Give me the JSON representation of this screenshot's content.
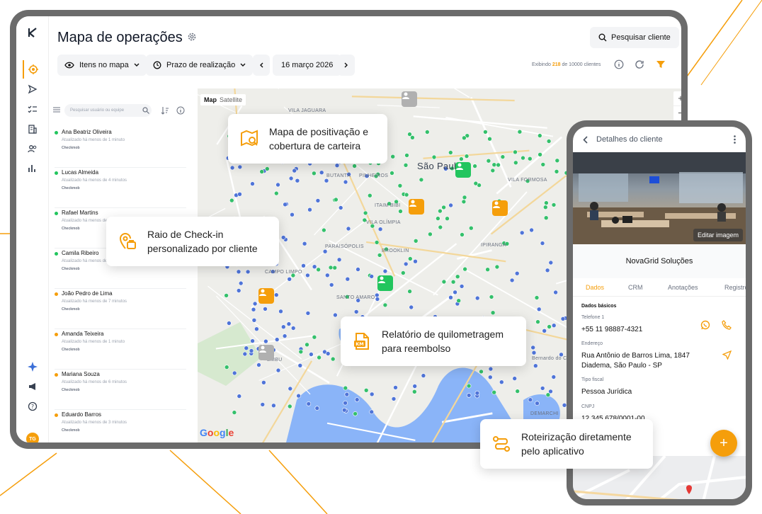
{
  "page": {
    "title": "Mapa de operações",
    "search_button": "Pesquisar cliente",
    "filters": {
      "items_on_map": "Itens no mapa",
      "deadline": "Prazo de realização",
      "date": "16 março 2026"
    },
    "showing": {
      "prefix": "Exibindo",
      "count": "218",
      "suffix": "de 10000 clientes"
    }
  },
  "users_panel": {
    "search_placeholder": "Pesquisar usuário ou equipe",
    "users": [
      {
        "name": "Ana Beatriz Oliveira",
        "updated": "Atualizado há menos de 1 minuto",
        "app": "Checkmob",
        "status_color": "#22c55e"
      },
      {
        "name": "Lucas Almeida",
        "updated": "Atualizado há menos de 4 minutos",
        "app": "Checkmob",
        "status_color": "#22c55e"
      },
      {
        "name": "Rafael Martins",
        "updated": "Atualizado há menos de 11 minutos",
        "app": "Checkmob",
        "status_color": "#22c55e"
      },
      {
        "name": "Camila Ribeiro",
        "updated": "Atualizado há menos de 4 minutos",
        "app": "Checkmob",
        "status_color": "#22c55e"
      },
      {
        "name": "João Pedro de Lima",
        "updated": "Atualizado há menos de 7 minutos",
        "app": "Checkmob",
        "status_color": "#f59e0b"
      },
      {
        "name": "Amanda Teixeira",
        "updated": "Atualizado há menos de 1 minuto",
        "app": "Checkmob",
        "status_color": "#f59e0b"
      },
      {
        "name": "Mariana Souza",
        "updated": "Atualizado há menos de 6 minutos",
        "app": "Checkmob",
        "status_color": "#f59e0b"
      },
      {
        "name": "Eduardo Barros",
        "updated": "Atualizado há menos de 3 minutos",
        "app": "Checkmob",
        "status_color": "#f59e0b"
      }
    ]
  },
  "map": {
    "type_map": "Map",
    "type_satellite": "Satellite",
    "zoom_in": "+",
    "zoom_out": "−",
    "google": "Google",
    "labels": [
      "VILA JAGUARA",
      "BUTANTÃ",
      "PINHEIROS",
      "São Paulo",
      "ITAIM BIBI",
      "VILA OLÍMPIA",
      "PARAISÓPOLIS",
      "BROOKLIN",
      "CAMPO LIMPO",
      "SANTO AMARO",
      "VILA FORMOSA",
      "IPIRANGA",
      "EMBU",
      "Bernardo do Campo",
      "DEMARCHI"
    ]
  },
  "callouts": {
    "positivacao": [
      "Mapa de positivação e",
      "cobertura de carteira"
    ],
    "checkin": [
      "Raio de Check-in",
      "personalizado por cliente"
    ],
    "quilometragem": [
      "Relatório de quilometragem",
      "para reembolso"
    ],
    "roteirizacao": [
      "Roteirização diretamente",
      "pelo aplicativo"
    ]
  },
  "phone": {
    "header": "Detalhes do cliente",
    "edit_image": "Editar imagem",
    "company": "NovaGrid Soluções",
    "tabs": [
      "Dados",
      "CRM",
      "Anotações",
      "Registros"
    ],
    "section": "Dados básicos",
    "fields": [
      {
        "label": "Telefone 1",
        "value": "+55 11 98887-4321"
      },
      {
        "label": "Endereço",
        "value": "Rua Antônio de Barros Lima, 1847",
        "value2": "Diadema, São Paulo - SP"
      },
      {
        "label": "Tipo fiscal",
        "value": "Pessoa Jurídica"
      },
      {
        "label": "CNPJ",
        "value": "12.345.678/0001-00"
      }
    ],
    "fab": "+"
  },
  "colors": {
    "accent": "#f59e0b",
    "green": "#22c55e",
    "blue": "#3b6fd8",
    "frame": "#6b6b6b"
  }
}
